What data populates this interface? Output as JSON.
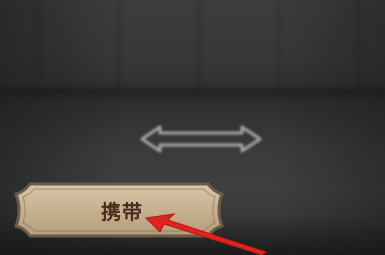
{
  "carry_button": {
    "label": "携带"
  },
  "icons": {
    "swap_arrow": "double-arrow-icon",
    "pointer": "red-pointer-arrow-icon"
  },
  "colors": {
    "plaque_fill": "#c9b596",
    "plaque_border": "#6b5a48",
    "label_text": "#4a2b1d",
    "pointer_red": "#e0231c",
    "background": "#3a3c3b"
  }
}
